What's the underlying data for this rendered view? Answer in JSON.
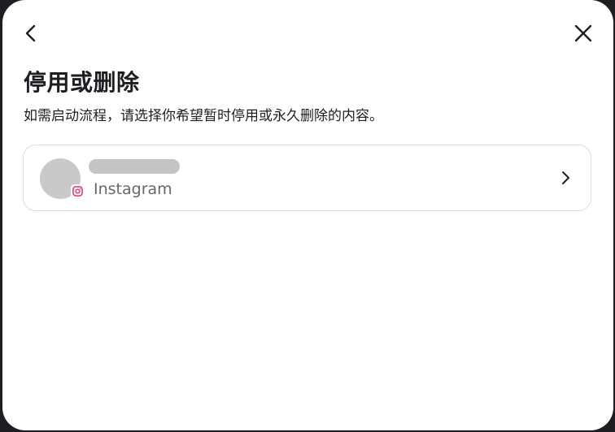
{
  "dialog": {
    "title": "停用或删除",
    "subtitle": "如需启动流程，请选择你希望暂时停用或永久删除的内容。",
    "back_icon": "chevron-left-icon",
    "close_icon": "close-icon"
  },
  "account": {
    "name": "",
    "platform": "Instagram",
    "platform_icon": "instagram-icon",
    "chevron_icon": "chevron-right-icon"
  },
  "colors": {
    "text_primary": "#1c1e21",
    "text_secondary": "#65676b",
    "card_border": "#dadde1",
    "instagram_accent": "#e1306c"
  }
}
